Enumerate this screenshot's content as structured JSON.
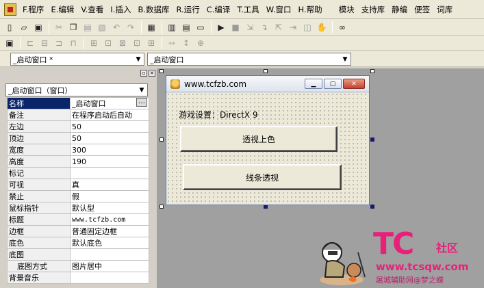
{
  "menu": [
    "F.程序",
    "E.编辑",
    "V.查看",
    "I.插入",
    "B.数据库",
    "R.运行",
    "C.编译",
    "T.工具",
    "W.窗口",
    "H.帮助",
    "模块",
    "支持库",
    "静编",
    "便签",
    "词库"
  ],
  "toolbar1_icons": [
    "new-file-icon",
    "open-folder-icon",
    "save-icon",
    "cut-icon",
    "copy-icon",
    "paste-icon",
    "delete-icon",
    "undo-icon",
    "redo-icon",
    "find-icon",
    "layout-1-icon",
    "layout-2-icon",
    "layout-3-icon",
    "run-icon",
    "stop-icon",
    "step-into-icon",
    "step-over-icon",
    "step-out-icon",
    "run-to-cursor-icon",
    "breakpoint-icon",
    "hand-icon",
    "binoculars-icon"
  ],
  "toolbar2_icons": [
    "form-icon",
    "align-left-icon",
    "align-center-icon",
    "align-right-icon",
    "align-top-icon",
    "align-middle-icon",
    "align-bottom-icon",
    "same-width-icon",
    "same-height-icon",
    "same-size-icon",
    "space-horizontal-icon",
    "space-vertical-icon",
    "center-form-icon"
  ],
  "combo_left": "_启动窗口 *",
  "combo_right": "_启动窗口",
  "object_combo": "_启动窗口（窗口）",
  "properties": [
    {
      "name": "名称",
      "value": "_启动窗口",
      "selected": true
    },
    {
      "name": "备注",
      "value": "在程序启动后自动"
    },
    {
      "name": "左边",
      "value": "50"
    },
    {
      "name": "顶边",
      "value": "50"
    },
    {
      "name": "宽度",
      "value": "300"
    },
    {
      "name": "高度",
      "value": "190"
    },
    {
      "name": "标记",
      "value": ""
    },
    {
      "name": "可视",
      "value": "真"
    },
    {
      "name": "禁止",
      "value": "假"
    },
    {
      "name": "鼠标指针",
      "value": "默认型"
    },
    {
      "name": "标题",
      "value": "www.tcfzb.com",
      "mono": true
    },
    {
      "name": "边框",
      "value": "普通固定边框"
    },
    {
      "name": "底色",
      "value": "默认底色"
    },
    {
      "name": "底图",
      "value": ""
    },
    {
      "name": "底图方式",
      "value": "图片居中",
      "indent": true
    },
    {
      "name": "背景音乐",
      "value": ""
    }
  ],
  "form": {
    "title": "www.tcfzb.com",
    "label": "游戏设置：DirectX 9",
    "button1": "透视上色",
    "button2": "线条透视"
  },
  "watermark": {
    "brand": "TC",
    "community": "社区",
    "url": "www.tcsqw.com",
    "caption": "屠城辅助网@梦之蝶"
  },
  "colors": {
    "selection": "#0a246a",
    "watermark": "#e8207a"
  }
}
